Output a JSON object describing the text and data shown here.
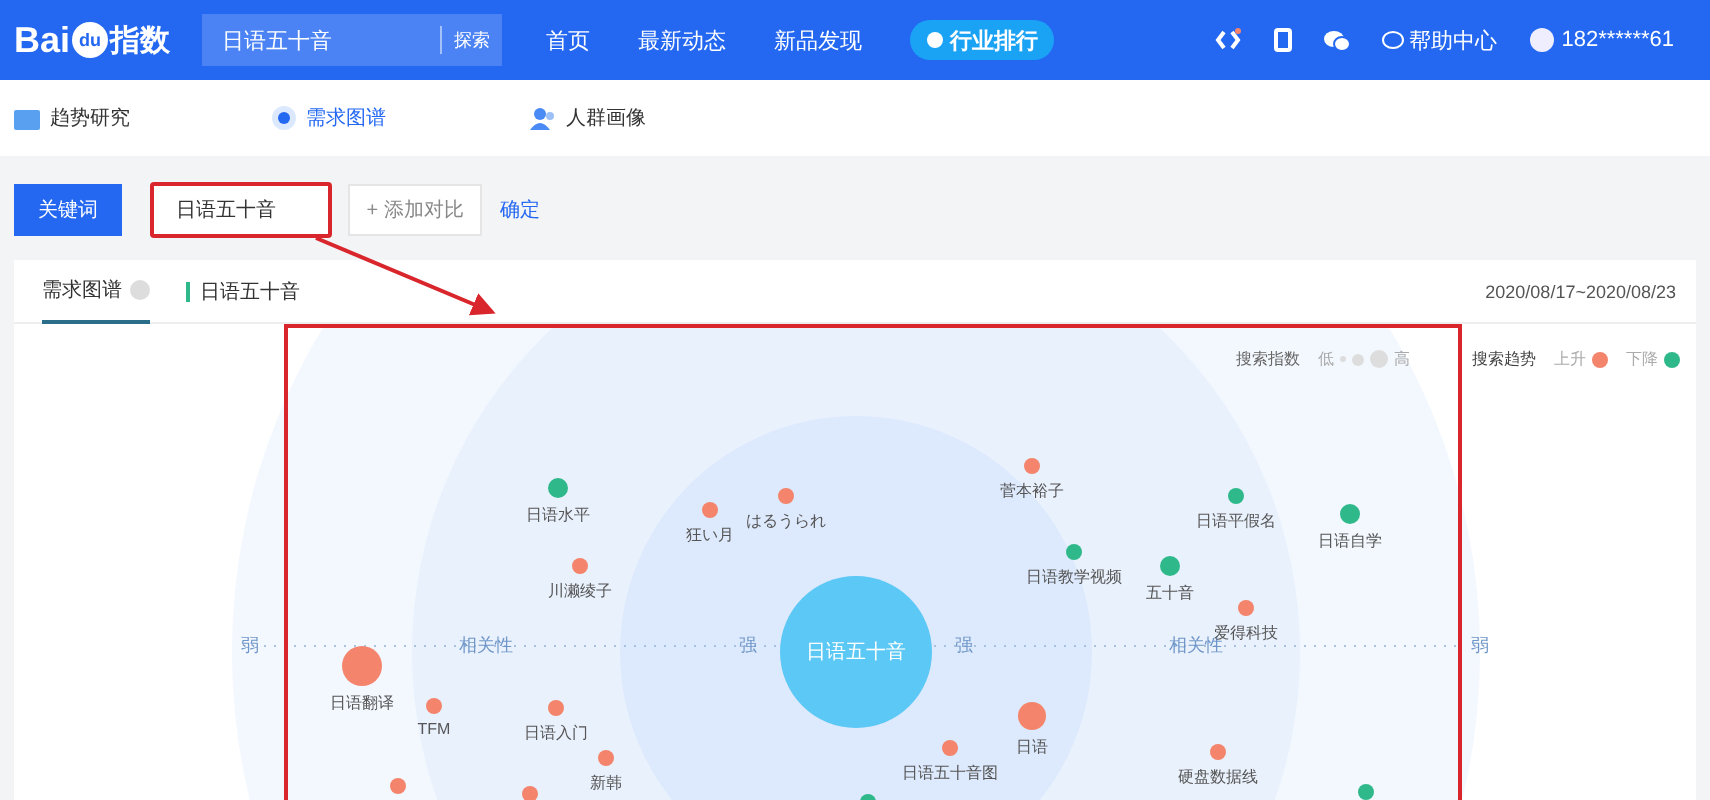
{
  "header": {
    "logo": {
      "text": "Bai",
      "paw_text": "du",
      "suffix": "指数"
    },
    "search": {
      "value": "日语五十音",
      "button": "探索"
    },
    "nav": [
      "首页",
      "最新动态",
      "新品发现"
    ],
    "ranking": "行业排行",
    "help": "帮助中心",
    "user": "182******61"
  },
  "subnav": [
    {
      "label": "趋势研究",
      "kind": "trend",
      "selected": false
    },
    {
      "label": "需求图谱",
      "kind": "demand",
      "selected": true
    },
    {
      "label": "人群画像",
      "kind": "crowd",
      "selected": false
    }
  ],
  "toolbar": {
    "keyword_button": "关键词",
    "keyword_value": "日语五十音",
    "add_compare": "+ 添加对比",
    "confirm": "确定"
  },
  "card": {
    "tabs": [
      {
        "label": "需求图谱",
        "selected": true
      }
    ],
    "keyword": "日语五十音",
    "date_range": "2020/08/17~2020/08/23"
  },
  "legend": {
    "index_label": "搜索指数",
    "low": "低",
    "high": "高",
    "trend_label": "搜索趋势",
    "trends": [
      {
        "label": "上升",
        "color": "#f4846b"
      },
      {
        "label": "下降",
        "color": "#2fb98a"
      }
    ]
  },
  "graph": {
    "center": "日语五十音",
    "axis_labels": [
      "弱",
      "相关性",
      "强",
      "强",
      "相关性",
      "弱"
    ],
    "nodes": [
      {
        "label": "日语水平",
        "color": "#2fb98a"
      },
      {
        "label": "狂い月",
        "color": "#f4846b"
      },
      {
        "label": "はるうられ",
        "color": "#f4846b"
      },
      {
        "label": "菅本裕子",
        "color": "#f4846b"
      },
      {
        "label": "日语平假名",
        "color": "#2fb98a"
      },
      {
        "label": "日语自学",
        "color": "#2fb98a"
      },
      {
        "label": "日语教学视频",
        "color": "#2fb98a"
      },
      {
        "label": "五十音",
        "color": "#2fb98a"
      },
      {
        "label": "川濑绫子",
        "color": "#f4846b"
      },
      {
        "label": "爱得科技",
        "color": "#f4846b"
      },
      {
        "label": "日语翻译",
        "color": "#f4846b"
      },
      {
        "label": "TFM",
        "color": "#f4846b"
      },
      {
        "label": "日语入门",
        "color": "#f4846b"
      },
      {
        "label": "新韩",
        "color": "#f4846b"
      },
      {
        "label": "日语",
        "color": "#f4846b"
      },
      {
        "label": "日语五十音图",
        "color": "#f4846b"
      },
      {
        "label": "硬盘数据线",
        "color": "#f4846b"
      },
      {
        "color": "#f4846b"
      },
      {
        "color": "#f4846b"
      },
      {
        "color": "#2fb98a"
      },
      {
        "color": "#2fb98a"
      }
    ]
  }
}
